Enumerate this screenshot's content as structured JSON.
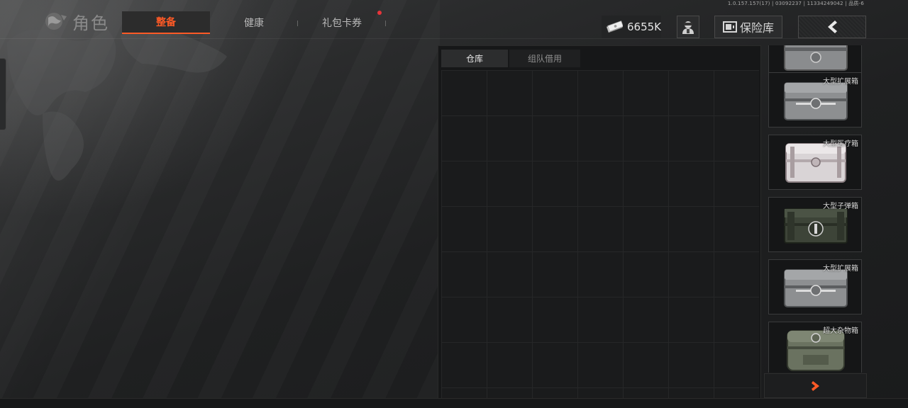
{
  "version_text": "1.0.157.157(17) | 03092237 | 11334249042 | 品质-6",
  "header": {
    "title": "角色",
    "tabs": [
      {
        "label": "整备",
        "active": true
      },
      {
        "label": "健康",
        "active": false
      },
      {
        "label": "礼包卡券",
        "active": false,
        "has_notification": true
      }
    ],
    "currency_value": "6655K",
    "vault_label": "保险库",
    "icons": {
      "title": "world-map-icon",
      "currency": "cash-stack-icon",
      "support": "agent-icon",
      "vault": "safe-icon",
      "back": "chevron-left-icon"
    }
  },
  "storage": {
    "tabs": [
      {
        "label": "仓库",
        "active": true
      },
      {
        "label": "组队借用",
        "active": false
      }
    ]
  },
  "items": [
    {
      "name": "",
      "style": "silver"
    },
    {
      "name": "大型扩展箱",
      "style": "silver"
    },
    {
      "name": "大型医疗箱",
      "style": "white"
    },
    {
      "name": "大型子弹箱",
      "style": "green"
    },
    {
      "name": "大型扩展箱",
      "style": "silver"
    },
    {
      "name": "超大杂物箱",
      "style": "olive"
    }
  ],
  "colors": {
    "accent": "#ff5a26",
    "notification": "#e8343a"
  }
}
